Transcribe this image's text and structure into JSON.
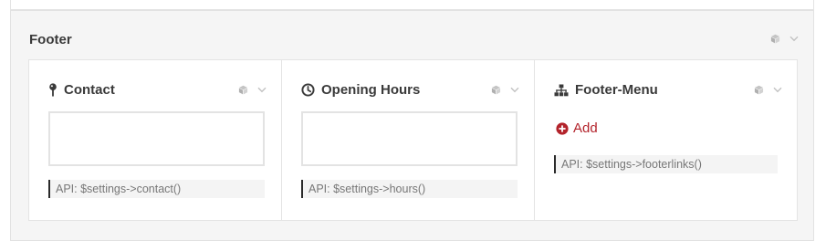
{
  "panel": {
    "title": "Footer",
    "tools": {
      "cube_icon": "cube-icon",
      "chevron_icon": "chevron-down-icon"
    }
  },
  "cards": {
    "contact": {
      "title": "Contact",
      "icon": "map-pin-icon",
      "field_value": "",
      "api_hint": "API: $settings->contact()"
    },
    "hours": {
      "title": "Opening Hours",
      "icon": "clock-icon",
      "field_value": "",
      "api_hint": "API: $settings->hours()"
    },
    "menu": {
      "title": "Footer-Menu",
      "icon": "sitemap-icon",
      "add_label": "Add",
      "api_hint": "API: $settings->footerlinks()"
    }
  },
  "colors": {
    "panel_bg": "#f5f5f5",
    "card_bg": "#ffffff",
    "accent_red": "#b3232b",
    "hint_bg": "#f4f4f4"
  }
}
